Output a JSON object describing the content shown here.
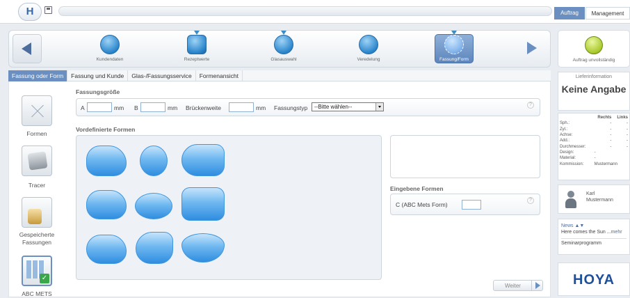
{
  "header": {
    "logo": "H",
    "tabs": [
      "Auftrag",
      "Management"
    ]
  },
  "steps": [
    {
      "label": "Kundendaten",
      "marker": false
    },
    {
      "label": "Rezeptwerte",
      "marker": true
    },
    {
      "label": "Glasauswahl",
      "marker": true
    },
    {
      "label": "Veredelung",
      "marker": false
    },
    {
      "label": "Fassung/Form",
      "marker": true,
      "active": true
    }
  ],
  "subtabs": [
    "Fassung oder Form",
    "Fassung und Kunde",
    "Glas-/Fassungsservice",
    "Formenansicht"
  ],
  "sidebar": [
    "Formen",
    "Tracer",
    "Gespeicherte Fassungen",
    "ABC METS"
  ],
  "form": {
    "size_heading": "Fassungsgröße",
    "label_a": "A",
    "label_b": "B",
    "unit": "mm",
    "bridge_label": "Brückenweite",
    "type_label": "Fassungstyp",
    "type_value": "--Bitte wählen--",
    "help": "?",
    "predefined_heading": "Vordefinierte Formen",
    "entered_heading": "Eingebene Formen",
    "c_label": "C (ABC Mets Form)",
    "next_label": "Weiter"
  },
  "right": {
    "order_status": "Auftrag unvollständig",
    "supply_label": "Lieferinformation",
    "supply_value": "Keine Angabe",
    "table_headers": [
      "",
      "Rechts",
      "Links"
    ],
    "table_rows": [
      [
        "Sph.:",
        "-",
        "-"
      ],
      [
        "Zyl.:",
        "-",
        "-"
      ],
      [
        "Achse:",
        "-",
        "-"
      ],
      [
        "Add.:",
        "-",
        "-"
      ],
      [
        "Durchmesser:",
        "-",
        "-"
      ]
    ],
    "design_label": "Design:",
    "design_value": "-",
    "material_label": "Material:",
    "material_value": "-",
    "commission_label": "Kommission:",
    "commission_value": "Mustermann",
    "user_first": "Karl",
    "user_last": "Mustermann",
    "news_title": "News",
    "news_text": "Here comes the Sun ...",
    "news_more": "mehr",
    "seminar": "Seminarprogramm",
    "brand": "HOYA"
  },
  "colors": {
    "accent": "#6b8fc0",
    "lens": "#3f95de",
    "marker": "#3e8cc4"
  }
}
